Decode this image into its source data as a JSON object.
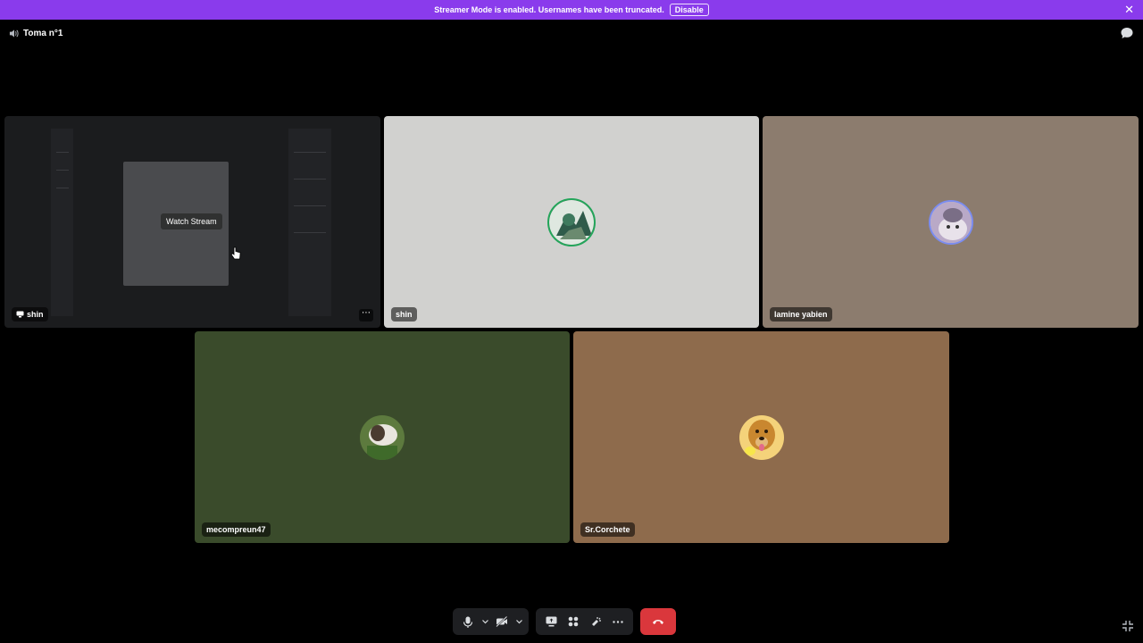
{
  "banner": {
    "message": "Streamer Mode is enabled. Usernames have been truncated.",
    "button_label": "Disable",
    "close_icon": "close-icon",
    "color": "#8a3bec"
  },
  "channel": {
    "name": "Toma n°1",
    "icon": "speaker-icon"
  },
  "stream_tile": {
    "user": "shin",
    "watch_label": "Watch Stream",
    "more_icon": "ellipsis-icon"
  },
  "tiles": [
    {
      "name": "shin",
      "color": "#d1d1cf"
    },
    {
      "name": "lamine yabien",
      "color": "#8c7c6e"
    },
    {
      "name": "mecompreun47",
      "color": "#3a4b2b"
    },
    {
      "name": "Sr.Corchete",
      "color": "#8e6b4c"
    }
  ],
  "controls": {
    "icons": [
      "microphone-icon",
      "chevron-down-icon",
      "camera-off-icon",
      "chevron-down-icon",
      "screen-share-icon",
      "activities-icon",
      "soundboard-icon",
      "ellipsis-icon",
      "hang-up-icon"
    ],
    "hangup_color": "#da373c"
  }
}
